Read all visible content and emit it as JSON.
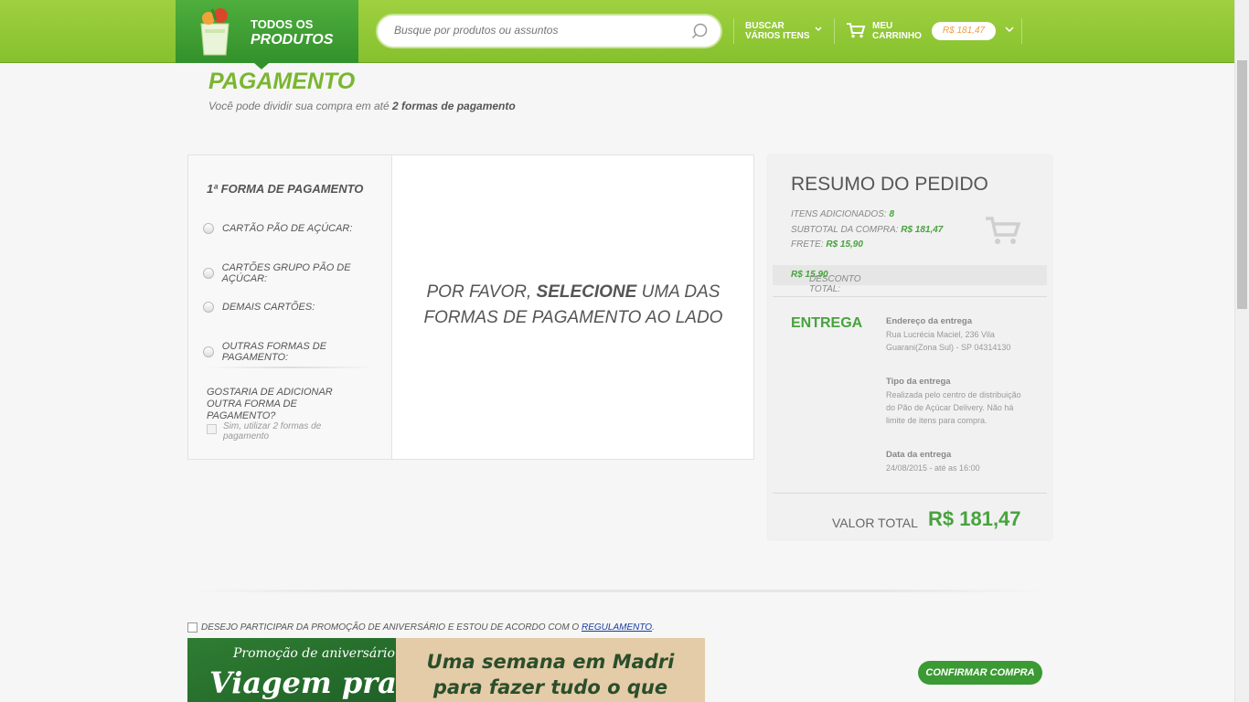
{
  "header": {
    "all_products_line1": "TODOS OS",
    "all_products_line2": "PRODUTOS",
    "search_placeholder": "Busque por produtos ou assuntos",
    "buscar_line1": "BUSCAR",
    "buscar_line2": "VÁRIOS ITENS",
    "cart_line1": "MEU",
    "cart_line2": "CARRINHO",
    "cart_amount": "R$ 181,47"
  },
  "page": {
    "title": "PAGAMENTO",
    "subtitle_prefix": "Você pode dividir sua compra em até",
    "subtitle_bold": "2 formas de pagamento"
  },
  "payment": {
    "heading": "1ª FORMA DE PAGAMENTO",
    "options": [
      "CARTÃO PÃO DE AÇÚCAR:",
      "CARTÕES GRUPO PÃO DE AÇÚCAR:",
      "DEMAIS CARTÕES:",
      "OUTRAS FORMAS DE PAGAMENTO:"
    ],
    "add_question": "GOSTARIA DE ADICIONAR OUTRA FORMA DE PAGAMENTO?",
    "add_checkbox_label": "Sim, utilizar 2 formas de pagamento",
    "message_pre": "POR FAVOR,",
    "message_bold": "SELECIONE",
    "message_post": "UMA DAS FORMAS DE PAGAMENTO AO LADO"
  },
  "summary": {
    "title": "RESUMO DO PEDIDO",
    "items_label": "ITENS ADICIONADOS:",
    "items_value": "8",
    "subtotal_label": "SUBTOTAL DA COMPRA:",
    "subtotal_value": "R$ 181,47",
    "frete_label": "FRETE:",
    "frete_value": "R$ 15,90",
    "discount_label": "DESCONTO TOTAL:",
    "discount_value": "R$ 15.90",
    "delivery_heading": "ENTREGA",
    "address_label": "Endereço da entrega",
    "address_value": "Rua Lucrécia Maciel, 236 Vila Guarani(Zona Sul) - SP 04314130",
    "type_label": "Tipo da entrega",
    "type_value": "Realizada pelo centro de distribuição do Pão de Açúcar Delivery. Não há limite de itens para compra.",
    "date_label": "Data da entrega",
    "date_value": "24/08/2015 - até as 16:00",
    "total_label": "VALOR TOTAL",
    "total_value": "R$ 181,47"
  },
  "promo": {
    "checkbox_text": "DESEJO PARTICIPAR DA PROMOÇÃO DE ANIVERSÁRIO E ESTOU DE ACORDO COM O",
    "link": "REGULAMENTO",
    "after_link": ".",
    "banner_title": "Promoção de aniversário",
    "banner_big": "Viagem pra",
    "banner_msg": "Uma semana em Madri para fazer tudo o que você imaginar."
  },
  "confirm_label": "CONFIRMAR COMPRA",
  "colors": {
    "brand_green": "#86c12e",
    "dark_green": "#33912c",
    "value_green": "#47a33d",
    "cart_orange": "#f39c3c"
  }
}
